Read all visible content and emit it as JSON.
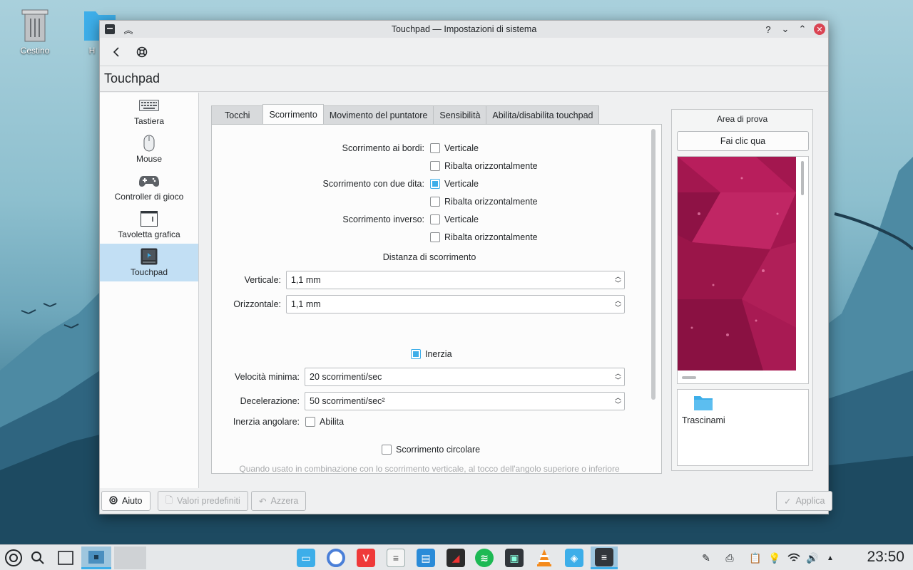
{
  "desktop": {
    "icons": [
      {
        "label": "Cestino"
      },
      {
        "label": "H"
      }
    ]
  },
  "window": {
    "title": "Touchpad — Impostazioni di sistema",
    "page_title": "Touchpad"
  },
  "sidebar": {
    "items": [
      {
        "label": "Tastiera",
        "icon": "keyboard-icon"
      },
      {
        "label": "Mouse",
        "icon": "mouse-icon"
      },
      {
        "label": "Controller di gioco",
        "icon": "gamepad-icon"
      },
      {
        "label": "Tavoletta grafica",
        "icon": "tablet-icon"
      },
      {
        "label": "Touchpad",
        "icon": "touchpad-icon",
        "active": true
      }
    ]
  },
  "tabs": [
    {
      "label": "Tocchi"
    },
    {
      "label": "Scorrimento",
      "active": true
    },
    {
      "label": "Movimento del puntatore"
    },
    {
      "label": "Sensibilità"
    },
    {
      "label": "Abilita/disabilita touchpad"
    }
  ],
  "scroll": {
    "edge_label": "Scorrimento ai bordi:",
    "edge_vertical": "Verticale",
    "edge_flip": "Ribalta orizzontalmente",
    "two_finger_label": "Scorrimento con due dita:",
    "two_finger_vertical": "Verticale",
    "two_finger_flip": "Ribalta orizzontalmente",
    "reverse_label": "Scorrimento inverso:",
    "reverse_vertical": "Verticale",
    "reverse_flip": "Ribalta orizzontalmente",
    "distance_heading": "Distanza di scorrimento",
    "vertical_label": "Verticale:",
    "vertical_value": "1,1 mm",
    "horizontal_label": "Orizzontale:",
    "horizontal_value": "1,1 mm",
    "inertia_label": "Inerzia",
    "min_speed_label": "Velocità minima:",
    "min_speed_value": "20 scorrimenti/sec",
    "deceleration_label": "Decelerazione:",
    "deceleration_value": "50 scorrimenti/sec²",
    "angular_label": "Inerzia angolare:",
    "angular_enable": "Abilita",
    "circular_label": "Scorrimento circolare",
    "note": "Quando usato in combinazione con lo scorrimento verticale, al tocco dell'angolo superiore o inferiore"
  },
  "test_area": {
    "title": "Area di prova",
    "click_button": "Fai clic qua",
    "drag_label": "Trascinami"
  },
  "footer": {
    "help": "Aiuto",
    "defaults": "Valori predefiniti",
    "reset": "Azzera",
    "apply": "Applica"
  },
  "taskbar": {
    "clock": "23:50"
  },
  "colors": {
    "accent": "#3daee9",
    "close": "#da4453",
    "selection": "#c2dff4"
  }
}
